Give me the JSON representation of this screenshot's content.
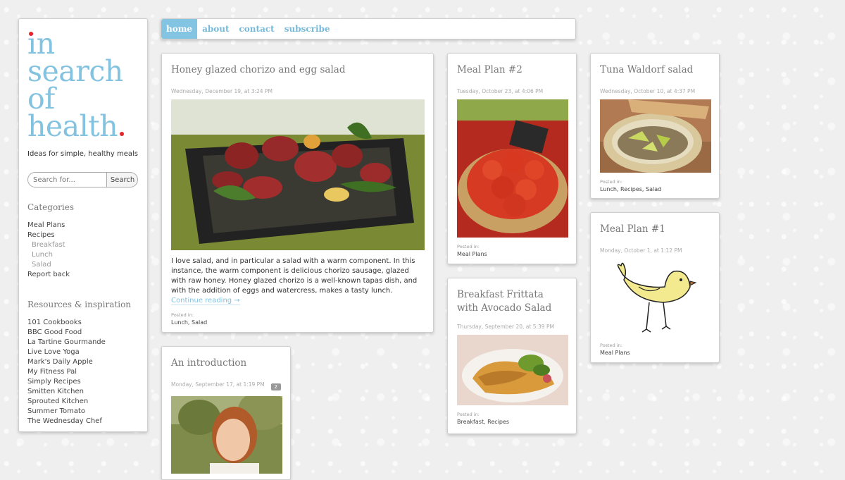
{
  "logo": {
    "line1": "in",
    "line2": "search",
    "line3": "of",
    "line4": "health",
    "tagline": "Ideas for simple, healthy meals"
  },
  "search": {
    "placeholder": "Search for...",
    "button": "Search"
  },
  "categories": {
    "heading": "Categories",
    "items": [
      {
        "label": "Meal Plans",
        "sub": false
      },
      {
        "label": "Recipes",
        "sub": false
      },
      {
        "label": "Breakfast",
        "sub": true
      },
      {
        "label": "Lunch",
        "sub": true
      },
      {
        "label": "Salad",
        "sub": true
      },
      {
        "label": "Report back",
        "sub": false
      }
    ]
  },
  "resources": {
    "heading": "Resources & inspiration",
    "items": [
      "101 Cookbooks",
      "BBC Good Food",
      "La Tartine Gourmande",
      "Live Love Yoga",
      "Mark's Daily Apple",
      "My Fitness Pal",
      "Simply Recipes",
      "Smitten Kitchen",
      "Sprouted Kitchen",
      "Summer Tomato",
      "The Wednesday Chef"
    ]
  },
  "nav": {
    "home": "home",
    "about": "about",
    "contact": "contact",
    "subscribe": "subscribe"
  },
  "posts": {
    "chorizo": {
      "title": "Honey glazed chorizo and egg salad",
      "date": "Wednesday, December 19, at 3:24 PM",
      "excerpt": "I love salad, and in particular a salad with a warm component. In this instance, the warm component is delicious chorizo sausage, glazed with raw honey. Honey glazed chorizo is a well-known tapas dish, and with the addition of eggs and watercress, makes a tasty lunch.",
      "more": "Continue reading →",
      "posted": "Posted in:",
      "cats": "Lunch, Salad"
    },
    "intro": {
      "title": "An introduction",
      "date": "Monday, September 17, at 1:19 PM",
      "comments": "2"
    },
    "mealplan2": {
      "title": "Meal Plan #2",
      "date": "Tuesday, October 23, at 4:06 PM",
      "posted": "Posted in:",
      "cats": "Meal Plans"
    },
    "frittata": {
      "title": "Breakfast Frittata with Avocado Salad",
      "date": "Thursday, September 20, at 5:39 PM",
      "posted": "Posted in:",
      "cats": "Breakfast, Recipes"
    },
    "tuna": {
      "title": "Tuna Waldorf salad",
      "date": "Wednesday, October 10, at 4:37 PM",
      "posted": "Posted in:",
      "cats": "Lunch, Recipes, Salad"
    },
    "mealplan1": {
      "title": "Meal Plan #1",
      "date": "Monday, October 1, at 1:12 PM",
      "posted": "Posted in:",
      "cats": "Meal Plans"
    }
  },
  "colors": {
    "accent": "#84c3e0",
    "dot": "#e8242d",
    "navActive": "#83c4e2"
  }
}
